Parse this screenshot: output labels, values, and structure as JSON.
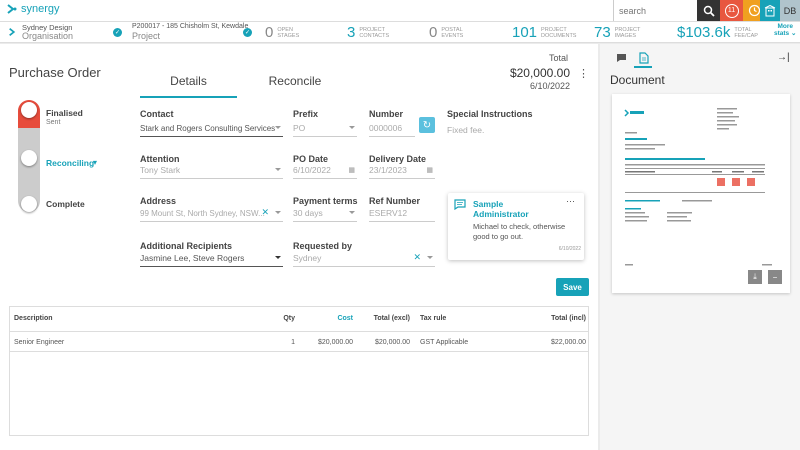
{
  "app": {
    "name": "synergy"
  },
  "topbar": {
    "search_placeholder": "search",
    "notif_count": "11",
    "user_initials": "DB"
  },
  "project": {
    "org_name": "Sydney Design",
    "org_type": "Organisation",
    "project_title": "P200017 - 185 Chisholm St, Kewdale",
    "project_type": "Project",
    "stats": [
      {
        "num": "0",
        "label1": "OPEN",
        "label2": "STAGES"
      },
      {
        "num": "3",
        "label1": "PROJECT",
        "label2": "CONTACTS"
      },
      {
        "num": "0",
        "label1": "POSTAL",
        "label2": "EVENTS"
      },
      {
        "num": "101",
        "label1": "PROJECT",
        "label2": "DOCUMENTS"
      },
      {
        "num": "73",
        "label1": "PROJECT",
        "label2": "IMAGES"
      },
      {
        "num": "$103.6k",
        "label1": "TOTAL",
        "label2": "FEE/CAP"
      }
    ],
    "more_label": "More",
    "stats_label": "stats"
  },
  "po": {
    "title": "Purchase Order",
    "tabs": [
      "Details",
      "Reconcile"
    ],
    "total_label": "Total",
    "total_value": "$20,000.00",
    "total_date": "6/10/2022",
    "stages": [
      {
        "label": "Finalised",
        "sub": "Sent"
      },
      {
        "label": "Reconciling",
        "sub": ""
      },
      {
        "label": "Complete",
        "sub": ""
      }
    ]
  },
  "form": {
    "contact_label": "Contact",
    "contact_value": "Stark and Rogers Consulting Services",
    "prefix_label": "Prefix",
    "prefix_value": "PO",
    "number_label": "Number",
    "number_value": "0000006",
    "special_label": "Special Instructions",
    "special_value": "Fixed fee.",
    "attention_label": "Attention",
    "attention_value": "Tony Stark",
    "podate_label": "PO Date",
    "podate_value": "6/10/2022",
    "delivery_label": "Delivery Date",
    "delivery_value": "23/1/2023",
    "address_label": "Address",
    "address_value": "99 Mount St, North Sydney, NSW...",
    "payment_label": "Payment terms",
    "payment_value": "30 days",
    "ref_label": "Ref Number",
    "ref_value": "ESERV12",
    "recipients_label": "Additional Recipients",
    "recipients_value": "Jasmine Lee, Steve Rogers",
    "requested_label": "Requested by",
    "requested_value": "Sydney",
    "save_label": "Save"
  },
  "note": {
    "author": "Sample Administrator",
    "text": "Michael to check, otherwise good to go out.",
    "date": "6/10/2022"
  },
  "table": {
    "headers": [
      "Description",
      "Qty",
      "Cost",
      "Total (excl)",
      "Tax rule",
      "Total (incl)"
    ],
    "rows": [
      [
        "Senior Engineer",
        "1",
        "$20,000.00",
        "$20,000.00",
        "GST Applicable",
        "$22,000.00"
      ]
    ]
  },
  "document": {
    "title": "Document"
  },
  "colors": {
    "accent": "#17a2b8",
    "danger": "#e74c3c",
    "save": "#17a2b8"
  }
}
